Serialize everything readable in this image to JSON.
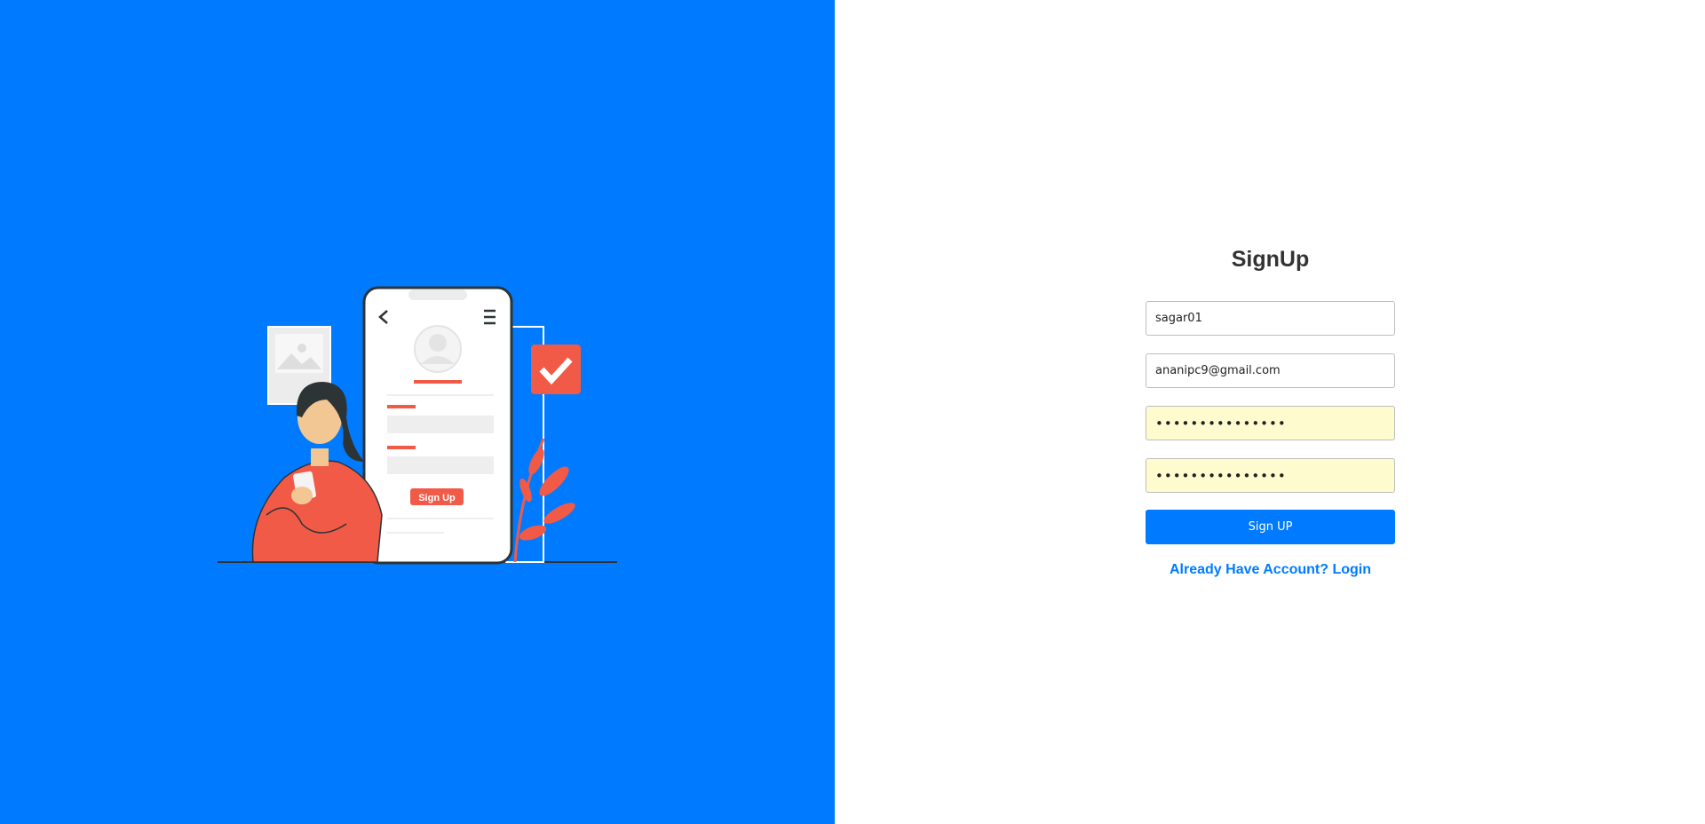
{
  "signup": {
    "title": "SignUp",
    "username_value": "sagar01",
    "email_value": "ananipc9@gmail.com",
    "password_value": "abcdefghijklmno",
    "confirm_password_value": "abcdefghijklmno",
    "submit_label": "Sign UP",
    "login_link_label": "Already Have Account? Login"
  },
  "illustration": {
    "phone_button_label": "Sign Up"
  },
  "colors": {
    "primary": "#007bff",
    "accent": "#f05a47",
    "autofill": "#fefcce"
  }
}
